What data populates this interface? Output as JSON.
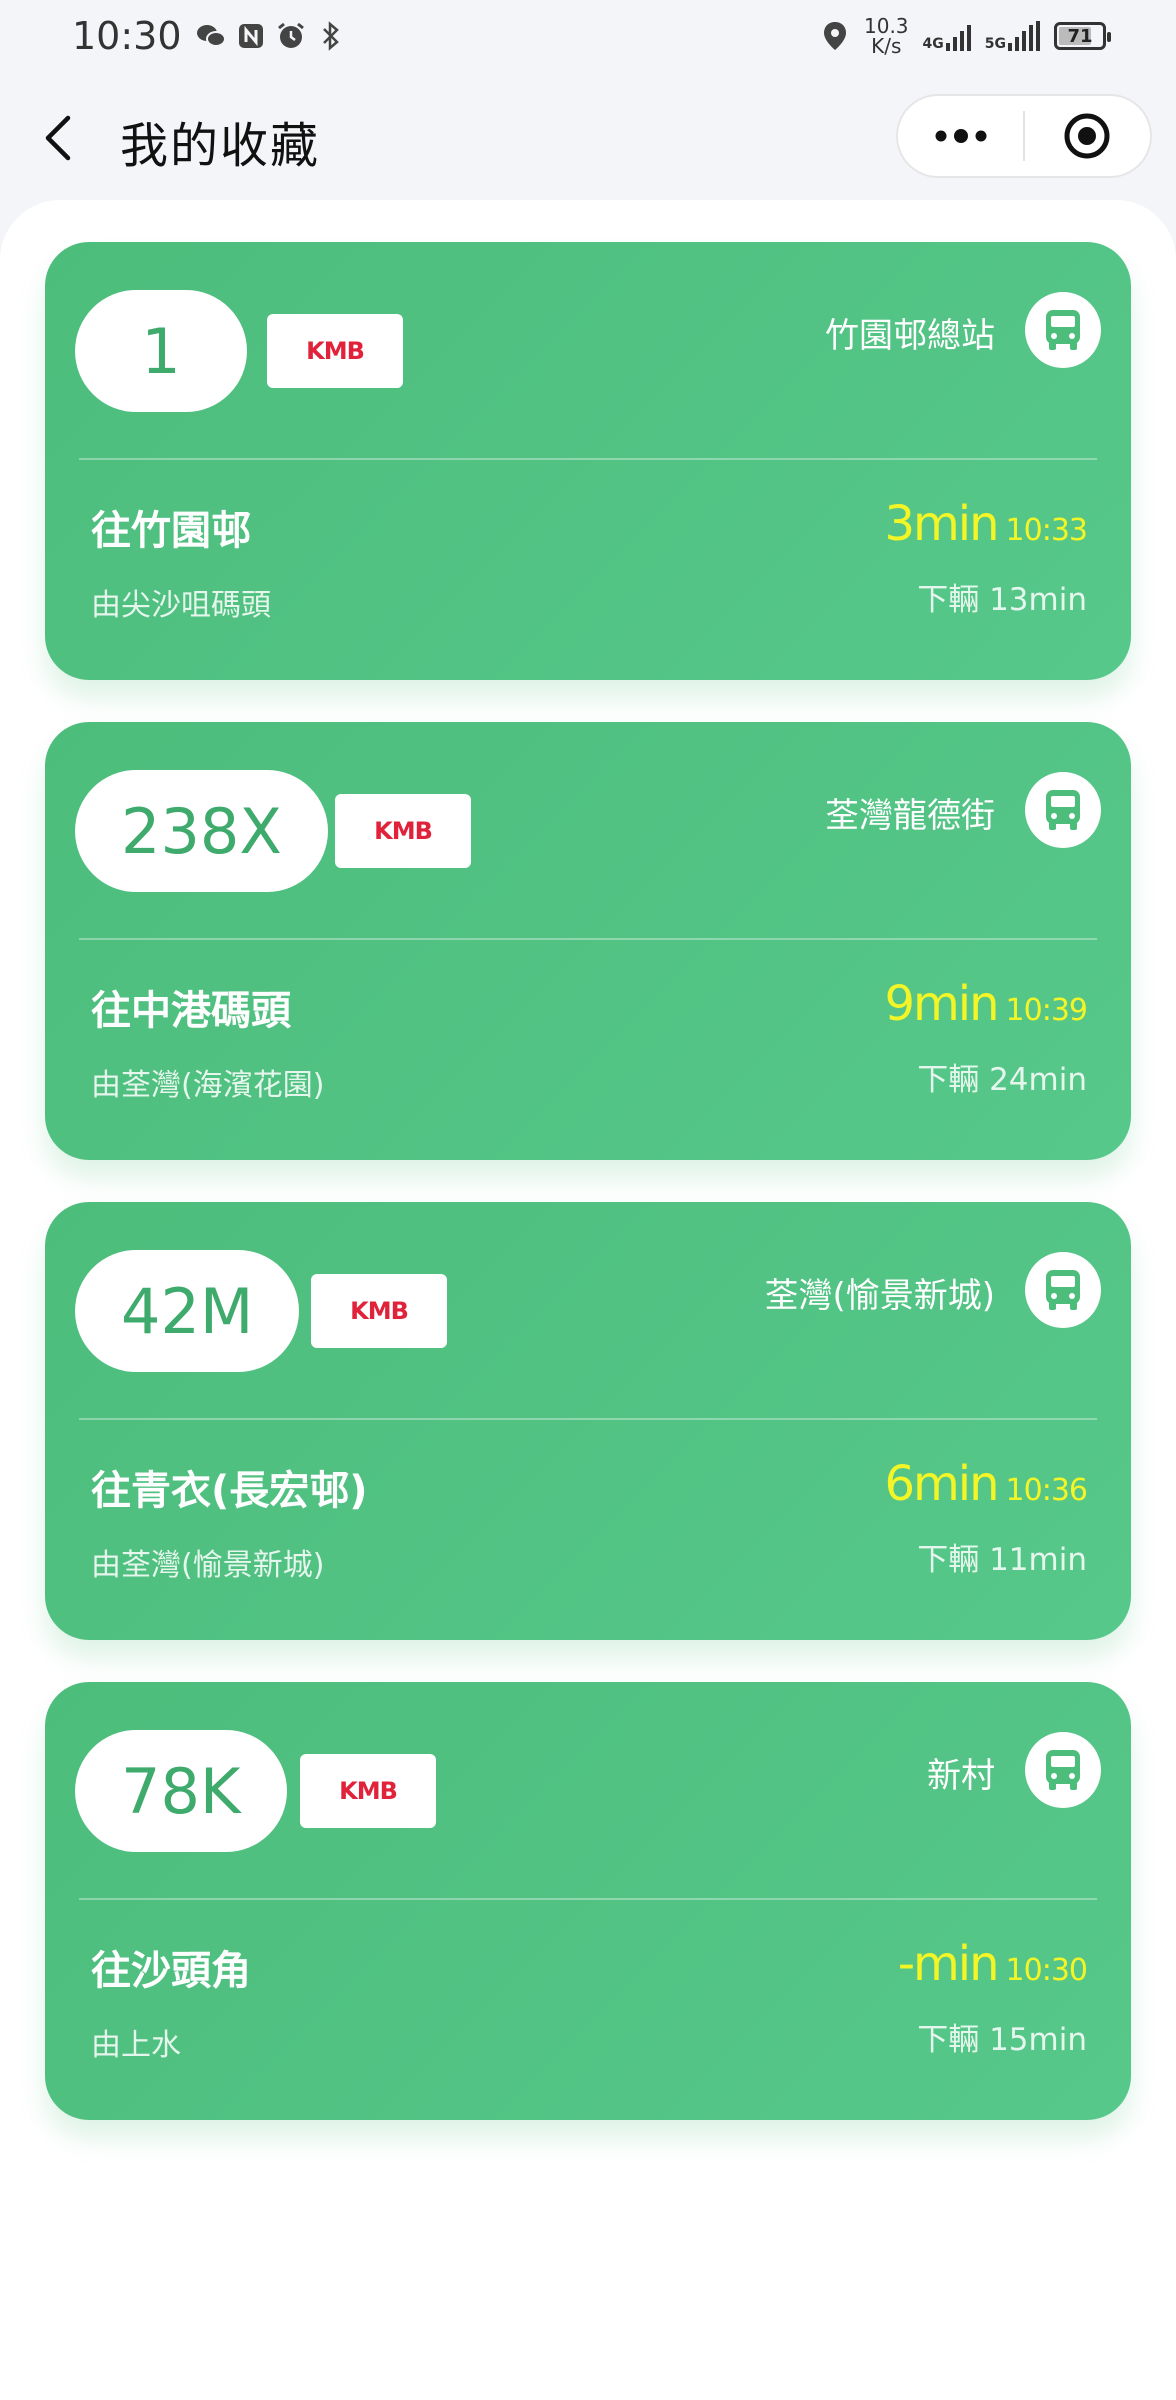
{
  "status_bar": {
    "time": "10:30",
    "net_speed_value": "10.3",
    "net_speed_unit": "K/s",
    "net_type_1": "4G",
    "net_type_2": "5G",
    "battery": "71"
  },
  "header": {
    "title": "我的收藏",
    "more_icon": "ellipsis-icon",
    "close_icon": "target-circle-icon"
  },
  "colors": {
    "card_green": "#4dbd7c",
    "route_text": "#3eaa6c",
    "eta_yellow": "#f3f526",
    "kmb_red": "#e0223a"
  },
  "favorites": [
    {
      "route": "1",
      "operator": "KMB",
      "stop": "竹園邨總站",
      "destination": "往竹園邨",
      "origin": "由尖沙咀碼頭",
      "eta_min": "3min",
      "eta_time": "10:33",
      "next": "下輛 13min"
    },
    {
      "route": "238X",
      "operator": "KMB",
      "stop": "荃灣龍德街",
      "destination": "往中港碼頭",
      "origin": "由荃灣(海濱花園)",
      "eta_min": "9min",
      "eta_time": "10:39",
      "next": "下輛 24min"
    },
    {
      "route": "42M",
      "operator": "KMB",
      "stop": "荃灣(愉景新城)",
      "destination": "往青衣(長宏邨)",
      "origin": "由荃灣(愉景新城)",
      "eta_min": "6min",
      "eta_time": "10:36",
      "next": "下輛 11min"
    },
    {
      "route": "78K",
      "operator": "KMB",
      "stop": "新村",
      "destination": "往沙頭角",
      "origin": "由上水",
      "eta_min": "-min",
      "eta_time": "10:30",
      "next": "下輛 15min"
    }
  ]
}
